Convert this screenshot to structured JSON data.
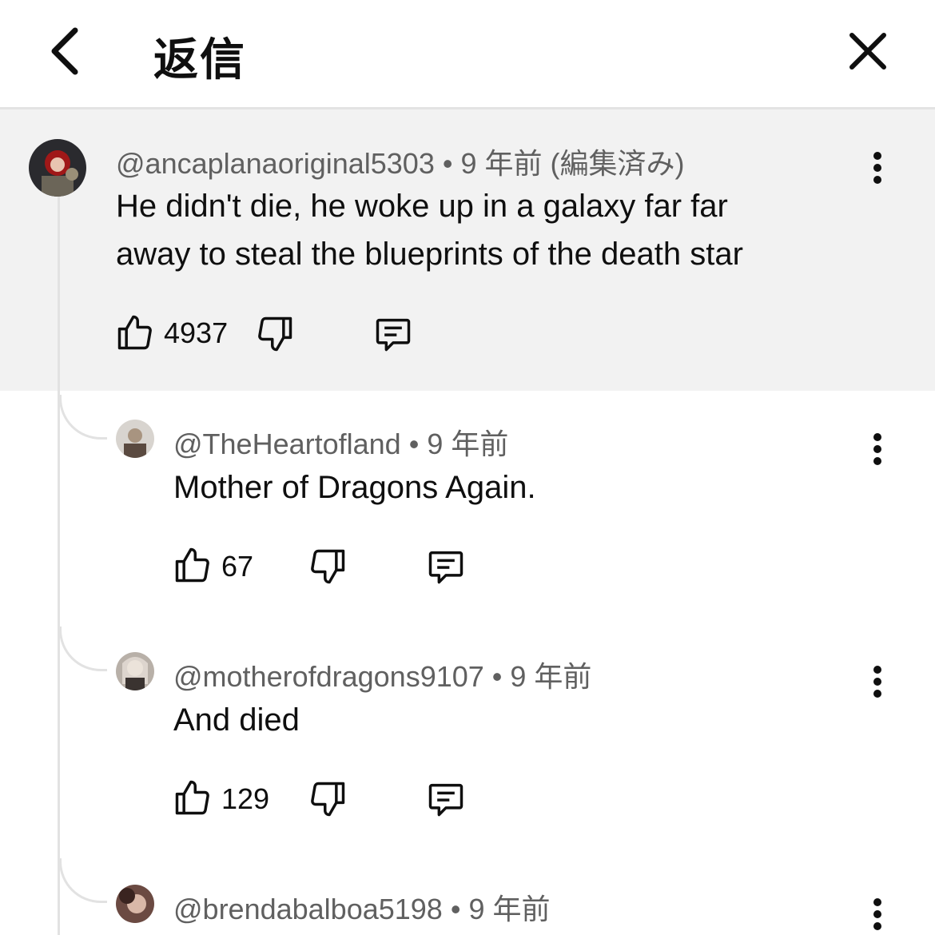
{
  "header": {
    "title": "返信"
  },
  "main_comment": {
    "author": "@ancaplanaoriginal5303",
    "time": "9 年前 (編集済み)",
    "text_line1": "He didn't die, he woke up in a galaxy far far",
    "text_line2": "away to steal the blueprints of the death star",
    "likes": "4937"
  },
  "replies": [
    {
      "author": "@TheHeartofland",
      "time": "9 年前",
      "text": "Mother of Dragons Again.",
      "likes": "67"
    },
    {
      "author": "@motherofdragons9107",
      "time": "9 年前",
      "text": "And died",
      "likes": "129"
    },
    {
      "author": "@brendabalboa5198",
      "time": "9 年前"
    }
  ],
  "meta_separator": "•",
  "colors": {
    "highlight_bg": "#f2f2f2",
    "meta_text": "#606060",
    "thread_line": "#e2e2e2"
  },
  "icons": [
    "back-arrow-icon",
    "close-icon",
    "thumbs-up-icon",
    "thumbs-down-icon",
    "reply-comment-icon",
    "more-vert-icon"
  ]
}
